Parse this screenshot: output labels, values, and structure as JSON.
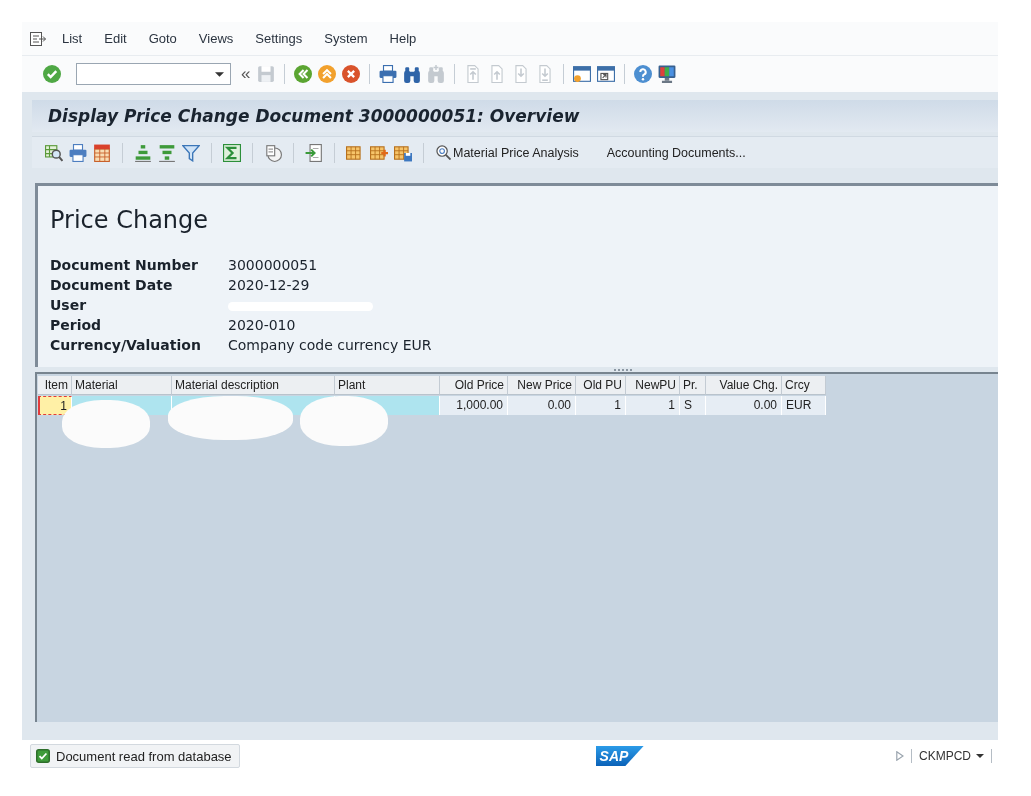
{
  "menu_bar": {
    "items": [
      "List",
      "Edit",
      "Goto",
      "Views",
      "Settings",
      "System",
      "Help"
    ]
  },
  "system_toolbar": {
    "groups": [
      [
        {
          "kind": "enter",
          "disabled": false
        },
        {
          "kind": "command_field",
          "disabled": false
        },
        {
          "kind": "collapse",
          "label": "«",
          "disabled": false
        },
        {
          "kind": "save",
          "disabled": true
        }
      ],
      [
        {
          "kind": "back",
          "disabled": false
        },
        {
          "kind": "exit",
          "disabled": false
        },
        {
          "kind": "cancel",
          "disabled": false
        }
      ],
      [
        {
          "kind": "print",
          "disabled": false
        },
        {
          "kind": "find",
          "disabled": false
        },
        {
          "kind": "find_next",
          "disabled": true
        }
      ],
      [
        {
          "kind": "first_page",
          "disabled": true
        },
        {
          "kind": "previous_page",
          "disabled": true
        },
        {
          "kind": "next_page",
          "disabled": true
        },
        {
          "kind": "last_page",
          "disabled": true
        }
      ],
      [
        {
          "kind": "new_session",
          "disabled": false
        },
        {
          "kind": "shortcut",
          "disabled": false
        }
      ],
      [
        {
          "kind": "help",
          "disabled": false
        },
        {
          "kind": "customize_layout",
          "disabled": false
        }
      ]
    ]
  },
  "title": "Display Price Change Document 3000000051: Overview",
  "app_toolbar": {
    "groups": [
      [
        {
          "kind": "details"
        },
        {
          "kind": "print"
        },
        {
          "kind": "spreadsheet"
        }
      ],
      [
        {
          "kind": "sort_ascending"
        },
        {
          "kind": "sort_descending"
        },
        {
          "kind": "filter"
        }
      ],
      [
        {
          "kind": "sum"
        }
      ],
      [
        {
          "kind": "subtotals"
        }
      ],
      [
        {
          "kind": "export"
        }
      ],
      [
        {
          "kind": "layout"
        },
        {
          "kind": "choose_layout"
        },
        {
          "kind": "save_layout"
        }
      ],
      [
        {
          "kind": "analysis_button",
          "label": "Material Price Analysis"
        },
        {
          "kind": "text_button",
          "label": "Accounting Documents..."
        }
      ]
    ]
  },
  "header": {
    "heading": "Price Change",
    "fields": [
      {
        "label": "Document Number",
        "value": "3000000051",
        "redacted": false
      },
      {
        "label": "Document Date",
        "value": "2020-12-29",
        "redacted": false
      },
      {
        "label": "User",
        "redacted": true
      },
      {
        "label": "Period",
        "value": "2020-010",
        "redacted": false
      },
      {
        "label": "Currency/Valuation",
        "value": "Company code currency EUR",
        "redacted": false
      }
    ]
  },
  "table": {
    "columns": [
      {
        "label": "Item",
        "kind": "number"
      },
      {
        "label": "Material",
        "kind": "text",
        "key": true
      },
      {
        "label": "Material description",
        "kind": "text",
        "key": true
      },
      {
        "label": "Plant",
        "kind": "text",
        "key": true
      },
      {
        "label": "Old Price",
        "kind": "number",
        "key": false
      },
      {
        "label": "New Price",
        "kind": "number",
        "key": false
      },
      {
        "label": "Old PU",
        "kind": "number",
        "key": false
      },
      {
        "label": "NewPU",
        "kind": "number",
        "key": false
      },
      {
        "label": "Pr.",
        "kind": "text",
        "key": false
      },
      {
        "label": "Value Chg.",
        "kind": "number",
        "key": false
      },
      {
        "label": "Crcy",
        "kind": "text",
        "key": false
      }
    ],
    "rows": [
      {
        "cells": [
          {
            "text": "1",
            "focused": true,
            "redacted": false
          },
          {
            "focused": false,
            "redacted": true
          },
          {
            "focused": false,
            "redacted": true
          },
          {
            "focused": false,
            "redacted": true
          },
          {
            "text": "1,000.00",
            "focused": false,
            "redacted": false
          },
          {
            "text": "0.00",
            "focused": false,
            "redacted": false
          },
          {
            "text": "1",
            "focused": false,
            "redacted": false
          },
          {
            "text": "1",
            "focused": false,
            "redacted": false
          },
          {
            "text": "S",
            "focused": false,
            "redacted": false
          },
          {
            "text": "0.00",
            "focused": false,
            "redacted": false
          },
          {
            "text": "EUR",
            "focused": false,
            "redacted": false
          }
        ]
      }
    ]
  },
  "status_bar": {
    "message": {
      "kind": "success",
      "text": "Document read from database"
    },
    "logo": "SAP",
    "transaction": "CKMPCD"
  }
}
